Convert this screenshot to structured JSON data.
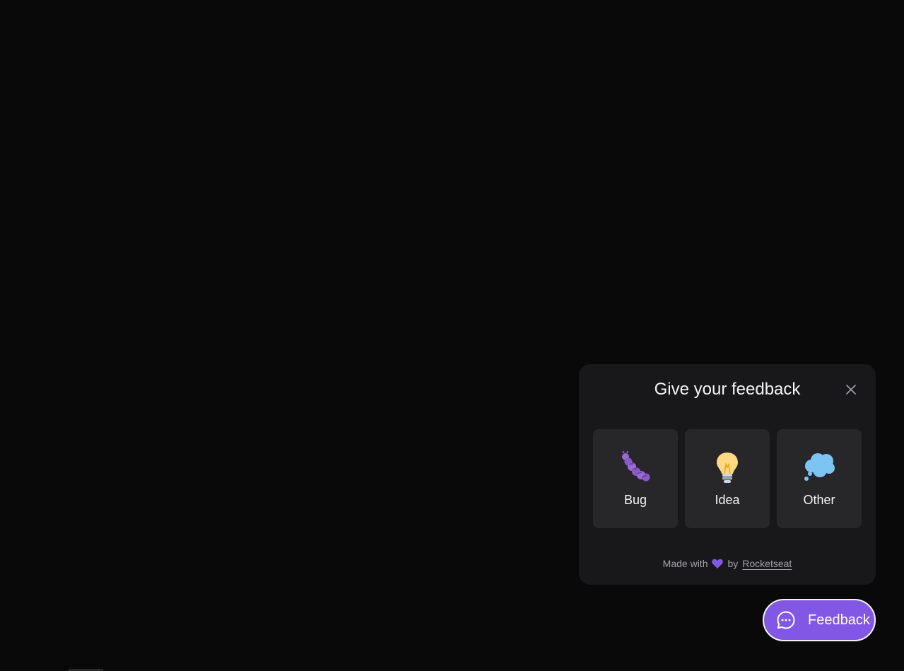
{
  "widget": {
    "title": "Give your feedback",
    "close_icon": "close-icon",
    "options": [
      {
        "label": "Bug",
        "icon": "caterpillar-icon"
      },
      {
        "label": "Idea",
        "icon": "lightbulb-icon"
      },
      {
        "label": "Other",
        "icon": "thought-bubble-icon"
      }
    ],
    "footer": {
      "made_with": "Made with",
      "by": "by",
      "link": "Rocketseat",
      "heart_icon": "heart-icon"
    }
  },
  "launcher": {
    "label": "Feedback",
    "icon": "chat-bubble-icon"
  },
  "colors": {
    "background": "#09090a",
    "panel": "#18181b",
    "option": "#27272a",
    "brand": "#8257e5",
    "text": "#f4f4f5",
    "muted": "#a1a1aa"
  }
}
